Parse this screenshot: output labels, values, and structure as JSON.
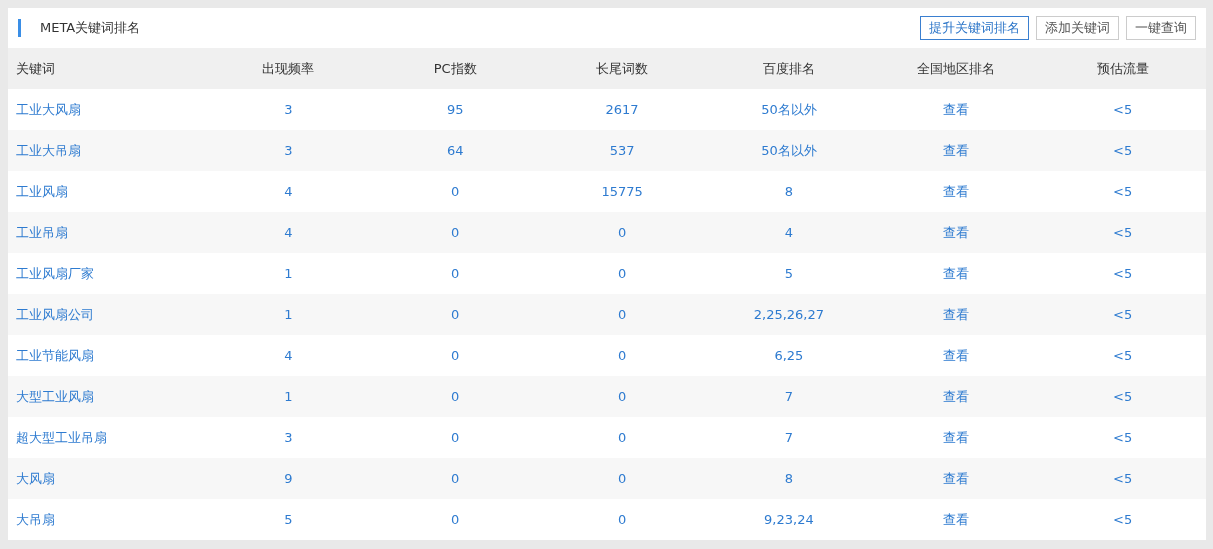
{
  "panel": {
    "title": "META关键词排名",
    "buttons": [
      {
        "label": "提升关键词排名",
        "kind": "primary"
      },
      {
        "label": "添加关键词",
        "kind": "plain"
      },
      {
        "label": "一键查询",
        "kind": "plain"
      }
    ]
  },
  "table": {
    "columns": [
      "关键词",
      "出现频率",
      "PC指数",
      "长尾词数",
      "百度排名",
      "全国地区排名",
      "预估流量"
    ],
    "rows": [
      [
        "工业大风扇",
        "3",
        "95",
        "2617",
        "50名以外",
        "查看",
        "<5"
      ],
      [
        "工业大吊扇",
        "3",
        "64",
        "537",
        "50名以外",
        "查看",
        "<5"
      ],
      [
        "工业风扇",
        "4",
        "0",
        "15775",
        "8",
        "查看",
        "<5"
      ],
      [
        "工业吊扇",
        "4",
        "0",
        "0",
        "4",
        "查看",
        "<5"
      ],
      [
        "工业风扇厂家",
        "1",
        "0",
        "0",
        "5",
        "查看",
        "<5"
      ],
      [
        "工业风扇公司",
        "1",
        "0",
        "0",
        "2,25,26,27",
        "查看",
        "<5"
      ],
      [
        "工业节能风扇",
        "4",
        "0",
        "0",
        "6,25",
        "查看",
        "<5"
      ],
      [
        "大型工业风扇",
        "1",
        "0",
        "0",
        "7",
        "查看",
        "<5"
      ],
      [
        "超大型工业吊扇",
        "3",
        "0",
        "0",
        "7",
        "查看",
        "<5"
      ],
      [
        "大风扇",
        "9",
        "0",
        "0",
        "8",
        "查看",
        "<5"
      ],
      [
        "大吊扇",
        "5",
        "0",
        "0",
        "9,23,24",
        "查看",
        "<5"
      ]
    ]
  }
}
